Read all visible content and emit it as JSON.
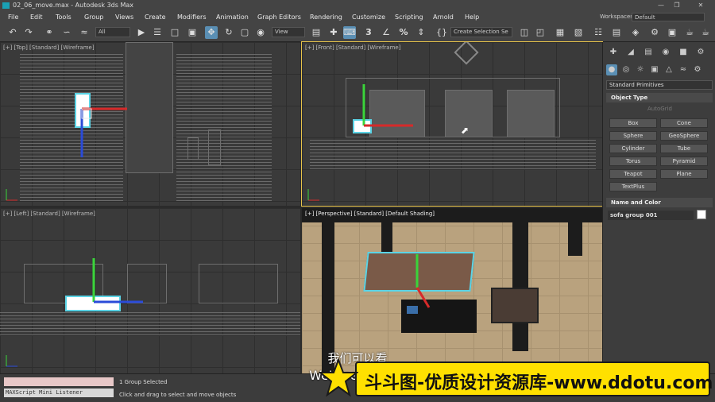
{
  "titlebar": {
    "title": "02_06_move.max - Autodesk 3ds Max"
  },
  "menu": {
    "items": [
      "File",
      "Edit",
      "Tools",
      "Group",
      "Views",
      "Create",
      "Modifiers",
      "Animation",
      "Graph Editors",
      "Rendering",
      "Customize",
      "Scripting",
      "Arnold",
      "Help"
    ],
    "workspaces_label": "Workspaces:",
    "workspaces_value": "Default"
  },
  "toolbar": {
    "filter_value": "All",
    "refcoord_value": "View",
    "selection_set_value": "Create Selection Se",
    "snap_label": "3",
    "angle_label": "%"
  },
  "viewports": {
    "top": "[+] [Top] [Standard] [Wireframe]",
    "front": "[+] [Front] [Standard] [Wireframe]",
    "left": "[+] [Left] [Standard] [Wireframe]",
    "perspective": "[+] [Perspective] [Standard] [Default Shading]"
  },
  "command_panel": {
    "category_value": "Standard Primitives",
    "object_type_title": "Object Type",
    "autogrid_label": "AutoGrid",
    "primitives": [
      "Box",
      "Cone",
      "Sphere",
      "GeoSphere",
      "Cylinder",
      "Tube",
      "Torus",
      "Pyramid",
      "Teapot",
      "Plane",
      "TextPlus"
    ],
    "name_color_title": "Name and Color",
    "object_name": "sofa group 001",
    "object_color": "#ffffff"
  },
  "status": {
    "listener_label": "MAXScript Mini Listener",
    "selection_info": "1 Group Selected",
    "prompt": "Click and drag to select and move objects"
  },
  "subtitle": {
    "cn": "我们可以看",
    "en": "We'll see up he"
  },
  "banner": {
    "text": "斗斗图-优质设计资源库-www.ddotu.com"
  },
  "colors": {
    "accent": "#5a8fb4",
    "selection": "#5ad4e6",
    "banner": "#ffe000",
    "active_viewport": "#e8c44a"
  }
}
